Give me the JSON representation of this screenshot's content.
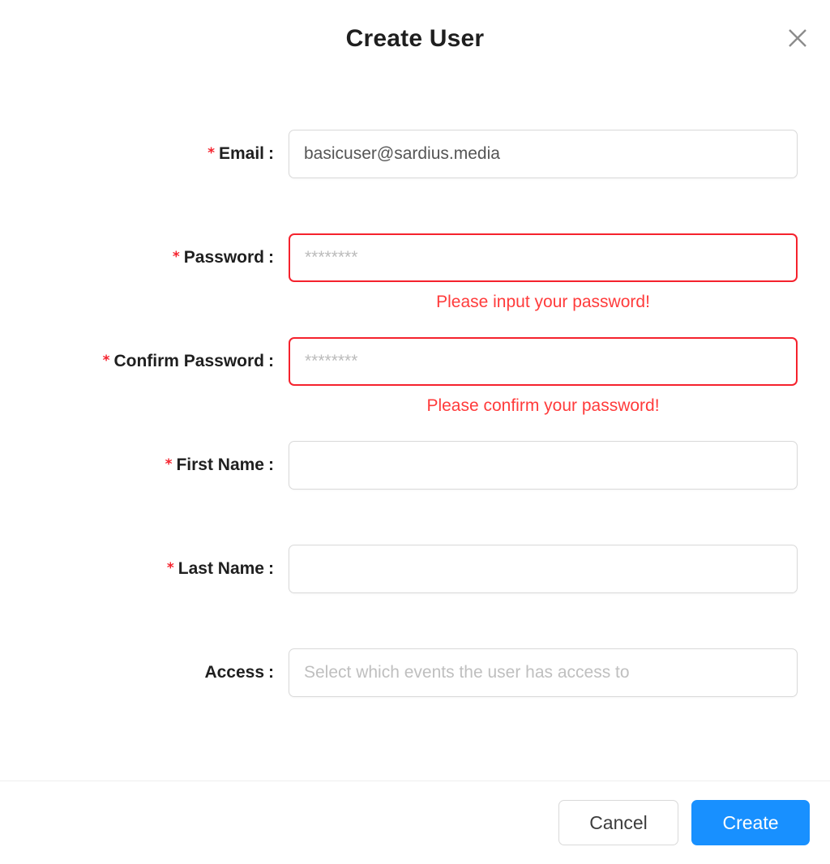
{
  "dialog": {
    "title": "Create User",
    "close_icon": "close-icon"
  },
  "form": {
    "fields": [
      {
        "id": "email",
        "label": "Email",
        "required_marker": "*",
        "colon": ":",
        "value": "basicuser@sardius.media",
        "placeholder": "",
        "error": "",
        "type": "text"
      },
      {
        "id": "password",
        "label": "Password",
        "required_marker": "*",
        "colon": ":",
        "value": "",
        "placeholder": "********",
        "error": "Please input your password!",
        "type": "password"
      },
      {
        "id": "confirm-password",
        "label": "Confirm Password",
        "required_marker": "*",
        "colon": ":",
        "value": "",
        "placeholder": "********",
        "error": "Please confirm your password!",
        "type": "password"
      },
      {
        "id": "first-name",
        "label": "First Name",
        "required_marker": "*",
        "colon": ":",
        "value": "",
        "placeholder": "",
        "error": "",
        "type": "text"
      },
      {
        "id": "last-name",
        "label": "Last Name",
        "required_marker": "*",
        "colon": ":",
        "value": "",
        "placeholder": "",
        "error": "",
        "type": "text"
      },
      {
        "id": "access",
        "label": "Access",
        "required_marker": "",
        "colon": ":",
        "value": "",
        "placeholder": "Select which events the user has access to",
        "error": "",
        "type": "select"
      }
    ]
  },
  "footer": {
    "cancel_label": "Cancel",
    "create_label": "Create"
  },
  "colors": {
    "primary": "#1890ff",
    "error": "#f5222d",
    "error_text": "#ff3b3b",
    "border": "#d9d9d9",
    "placeholder": "#bfbfbf",
    "title": "#1f1f1f"
  }
}
